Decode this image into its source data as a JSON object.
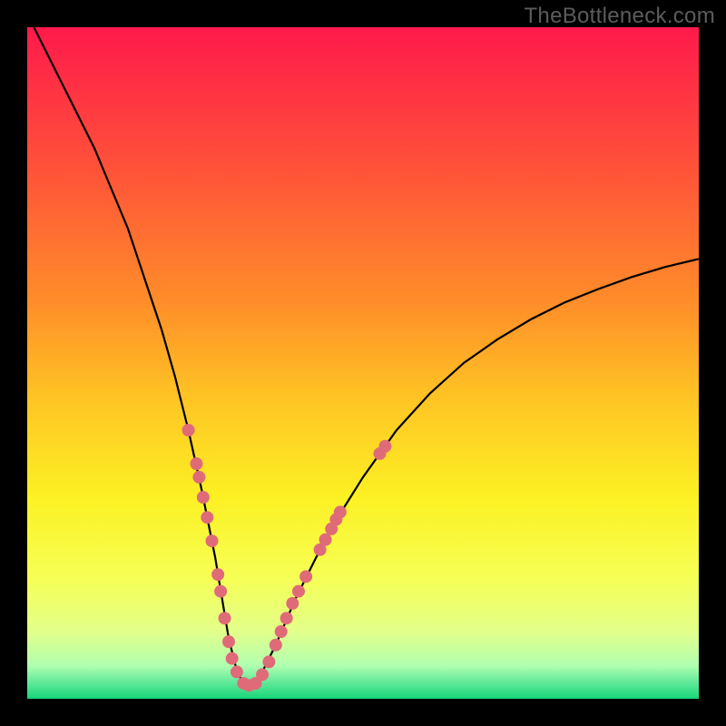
{
  "watermark": "TheBottleneck.com",
  "chart_data": {
    "type": "line",
    "title": "",
    "xlabel": "",
    "ylabel": "",
    "xlim": [
      0,
      100
    ],
    "ylim": [
      0,
      100
    ],
    "gradient_stops": [
      {
        "offset": 0.0,
        "color": "#ff1a4b"
      },
      {
        "offset": 0.2,
        "color": "#ff4f3a"
      },
      {
        "offset": 0.4,
        "color": "#ff8a2a"
      },
      {
        "offset": 0.55,
        "color": "#ffc324"
      },
      {
        "offset": 0.7,
        "color": "#fcf123"
      },
      {
        "offset": 0.82,
        "color": "#f6ff55"
      },
      {
        "offset": 0.9,
        "color": "#e2ff8a"
      },
      {
        "offset": 0.95,
        "color": "#b2ffb0"
      },
      {
        "offset": 0.975,
        "color": "#63e99a"
      },
      {
        "offset": 1.0,
        "color": "#17d67a"
      }
    ],
    "series": [
      {
        "name": "curve",
        "x": [
          1,
          5,
          10,
          15,
          18,
          20,
          22,
          24,
          26,
          28,
          29,
          30,
          31,
          32,
          33,
          34,
          35,
          37,
          40,
          45,
          50,
          55,
          60,
          65,
          70,
          75,
          80,
          85,
          90,
          95,
          100
        ],
        "y": [
          100,
          92,
          82,
          70,
          61,
          55,
          48,
          40,
          31,
          21,
          15,
          9,
          5,
          2.5,
          2,
          2.3,
          4,
          8,
          15,
          25,
          33,
          40,
          45.5,
          50,
          53.5,
          56.5,
          59,
          61,
          62.8,
          64.3,
          65.5
        ]
      }
    ],
    "highlight_points": {
      "name": "dots",
      "color": "#e06b78",
      "radius": 7,
      "points": [
        {
          "x": 24.0,
          "y": 40
        },
        {
          "x": 25.2,
          "y": 35
        },
        {
          "x": 25.6,
          "y": 33
        },
        {
          "x": 26.2,
          "y": 30
        },
        {
          "x": 26.8,
          "y": 27
        },
        {
          "x": 27.5,
          "y": 23.5
        },
        {
          "x": 28.4,
          "y": 18.5
        },
        {
          "x": 28.8,
          "y": 16
        },
        {
          "x": 29.4,
          "y": 12
        },
        {
          "x": 30.0,
          "y": 8.5
        },
        {
          "x": 30.5,
          "y": 6
        },
        {
          "x": 31.2,
          "y": 4
        },
        {
          "x": 32.2,
          "y": 2.3
        },
        {
          "x": 33.0,
          "y": 2.0
        },
        {
          "x": 34.0,
          "y": 2.3
        },
        {
          "x": 35.0,
          "y": 3.6
        },
        {
          "x": 36.0,
          "y": 5.5
        },
        {
          "x": 37.0,
          "y": 8.0
        },
        {
          "x": 37.8,
          "y": 10.0
        },
        {
          "x": 38.6,
          "y": 12.0
        },
        {
          "x": 39.5,
          "y": 14.2
        },
        {
          "x": 40.4,
          "y": 16.0
        },
        {
          "x": 41.5,
          "y": 18.2
        },
        {
          "x": 43.6,
          "y": 22.2
        },
        {
          "x": 44.4,
          "y": 23.7
        },
        {
          "x": 45.3,
          "y": 25.3
        },
        {
          "x": 46.0,
          "y": 26.7
        },
        {
          "x": 46.6,
          "y": 27.8
        },
        {
          "x": 52.5,
          "y": 36.5
        },
        {
          "x": 53.3,
          "y": 37.6
        }
      ]
    }
  }
}
